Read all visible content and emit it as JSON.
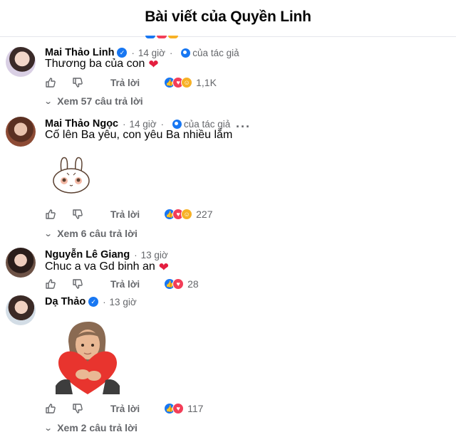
{
  "header": {
    "title": "Bài viết của Quyền Linh"
  },
  "colors": {
    "accent": "#1877f2",
    "love": "#f33e58",
    "care": "#f7b125",
    "secondary_text": "#65676b"
  },
  "labels": {
    "reply": "Trả lời",
    "author_badge": "của tác giả"
  },
  "comments": [
    {
      "name": "Mai Thảo Linh",
      "verified": true,
      "time": "14 giờ",
      "author_liked": true,
      "text": "Thương ba của con",
      "reactions": [
        "like",
        "love",
        "care"
      ],
      "reaction_count": "1,1K",
      "replies": "Xem 57 câu trả lời"
    },
    {
      "name": "Mai Thảo Ngọc",
      "verified": false,
      "time": "14 giờ",
      "author_liked": true,
      "text": "Cố lên Ba yêu, con yêu Ba nhiều lắm",
      "sticker": "bunny-sticker",
      "reactions": [
        "like",
        "love",
        "care"
      ],
      "reaction_count": "227",
      "replies": "Xem 6 câu trả lời"
    },
    {
      "name": "Nguyễn Lê Giang",
      "verified": false,
      "time": "13 giờ",
      "author_liked": false,
      "text": "Chuc a va Gd binh an",
      "reactions": [
        "like",
        "love"
      ],
      "reaction_count": "28"
    },
    {
      "name": "Dạ Thảo",
      "verified": true,
      "time": "13 giờ",
      "author_liked": false,
      "sticker": "avatar-heart-sticker",
      "reactions": [
        "like",
        "love"
      ],
      "reaction_count": "117",
      "replies": "Xem 2 câu trả lời"
    }
  ]
}
